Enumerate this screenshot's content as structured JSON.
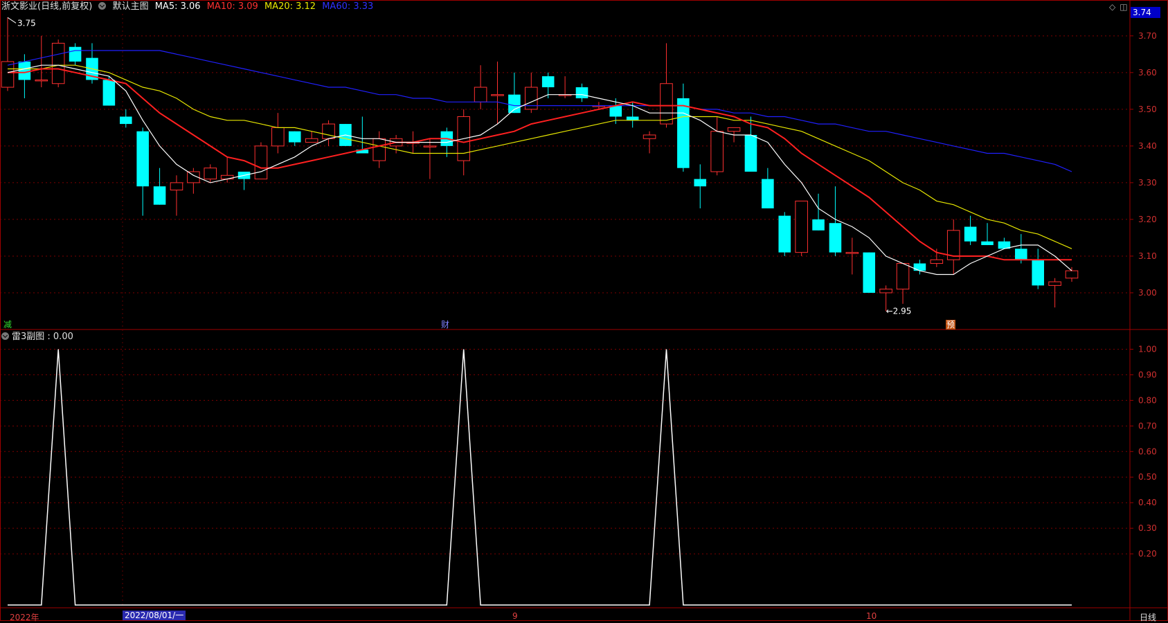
{
  "header": {
    "stock": "浙文影业(日线,前复权)",
    "template": "默认主图",
    "ma5": "MA5: 3.06",
    "ma10": "MA10: 3.09",
    "ma20": "MA20: 3.12",
    "ma60": "MA60: 3.33"
  },
  "indicator_header": "雷3副图 : 0.00",
  "current_price": "3.74",
  "high_label": "3.75",
  "low_label": "2.95",
  "event_markers": [
    "减",
    "财",
    "预"
  ],
  "bottom_labels": {
    "year": "2022年",
    "selected_date": "2022/08/01/一",
    "sep": "9",
    "oct": "10",
    "period": "日线"
  },
  "colors": {
    "up": "#ff3030",
    "down": "#00ffff",
    "ma5": "#ffffff",
    "ma10": "#ff2020",
    "ma20": "#e8e800",
    "ma60": "#2020ff",
    "axis": "#a00000"
  },
  "icons": [
    "diamond-icon",
    "window-icon",
    "collapse-icon"
  ],
  "chart_data": [
    {
      "type": "candlestick",
      "ylim": [
        2.9,
        3.76
      ],
      "yticks": [
        3.0,
        3.1,
        3.2,
        3.3,
        3.4,
        3.5,
        3.6,
        3.7
      ],
      "ohlc": [
        [
          3.56,
          3.75,
          3.55,
          3.63
        ],
        [
          3.63,
          3.65,
          3.53,
          3.58
        ],
        [
          3.58,
          3.7,
          3.56,
          3.58
        ],
        [
          3.57,
          3.69,
          3.56,
          3.68
        ],
        [
          3.67,
          3.68,
          3.62,
          3.63
        ],
        [
          3.64,
          3.68,
          3.57,
          3.58
        ],
        [
          3.58,
          3.59,
          3.51,
          3.51
        ],
        [
          3.48,
          3.5,
          3.45,
          3.46
        ],
        [
          3.44,
          3.45,
          3.21,
          3.29
        ],
        [
          3.29,
          3.34,
          3.24,
          3.24
        ],
        [
          3.28,
          3.32,
          3.21,
          3.3
        ],
        [
          3.3,
          3.34,
          3.27,
          3.33
        ],
        [
          3.31,
          3.35,
          3.3,
          3.34
        ],
        [
          3.31,
          3.37,
          3.3,
          3.32
        ],
        [
          3.33,
          3.33,
          3.28,
          3.31
        ],
        [
          3.31,
          3.41,
          3.31,
          3.4
        ],
        [
          3.4,
          3.49,
          3.38,
          3.45
        ],
        [
          3.44,
          3.44,
          3.4,
          3.41
        ],
        [
          3.41,
          3.44,
          3.41,
          3.42
        ],
        [
          3.42,
          3.47,
          3.4,
          3.46
        ],
        [
          3.46,
          3.46,
          3.4,
          3.4
        ],
        [
          3.39,
          3.48,
          3.38,
          3.38
        ],
        [
          3.36,
          3.44,
          3.34,
          3.42
        ],
        [
          3.4,
          3.43,
          3.38,
          3.42
        ],
        [
          3.41,
          3.44,
          3.38,
          3.41
        ],
        [
          3.4,
          3.42,
          3.31,
          3.4
        ],
        [
          3.44,
          3.45,
          3.37,
          3.4
        ],
        [
          3.36,
          3.5,
          3.32,
          3.48
        ],
        [
          3.52,
          3.62,
          3.5,
          3.56
        ],
        [
          3.54,
          3.63,
          3.46,
          3.54
        ],
        [
          3.54,
          3.6,
          3.49,
          3.49
        ],
        [
          3.5,
          3.6,
          3.49,
          3.56
        ],
        [
          3.59,
          3.6,
          3.53,
          3.56
        ],
        [
          3.54,
          3.59,
          3.53,
          3.54
        ],
        [
          3.56,
          3.57,
          3.52,
          3.53
        ],
        [
          3.51,
          3.52,
          3.5,
          3.51
        ],
        [
          3.51,
          3.53,
          3.46,
          3.48
        ],
        [
          3.48,
          3.52,
          3.45,
          3.47
        ],
        [
          3.42,
          3.44,
          3.38,
          3.43
        ],
        [
          3.46,
          3.68,
          3.45,
          3.57
        ],
        [
          3.53,
          3.57,
          3.33,
          3.34
        ],
        [
          3.31,
          3.35,
          3.23,
          3.29
        ],
        [
          3.33,
          3.48,
          3.32,
          3.44
        ],
        [
          3.44,
          3.45,
          3.41,
          3.45
        ],
        [
          3.43,
          3.48,
          3.33,
          3.33
        ],
        [
          3.31,
          3.34,
          3.23,
          3.23
        ],
        [
          3.21,
          3.22,
          3.1,
          3.11
        ],
        [
          3.11,
          3.25,
          3.1,
          3.25
        ],
        [
          3.2,
          3.27,
          3.17,
          3.17
        ],
        [
          3.19,
          3.29,
          3.1,
          3.11
        ],
        [
          3.11,
          3.15,
          3.05,
          3.11
        ],
        [
          3.11,
          3.11,
          3.0,
          3.0
        ],
        [
          3.0,
          3.02,
          2.95,
          3.01
        ],
        [
          3.01,
          3.08,
          2.97,
          3.08
        ],
        [
          3.08,
          3.09,
          3.05,
          3.06
        ],
        [
          3.08,
          3.12,
          3.07,
          3.09
        ],
        [
          3.09,
          3.2,
          3.05,
          3.17
        ],
        [
          3.18,
          3.21,
          3.13,
          3.14
        ],
        [
          3.14,
          3.19,
          3.13,
          3.13
        ],
        [
          3.14,
          3.15,
          3.12,
          3.12
        ],
        [
          3.12,
          3.16,
          3.08,
          3.09
        ],
        [
          3.09,
          3.12,
          3.01,
          3.02
        ],
        [
          3.02,
          3.04,
          2.96,
          3.03
        ],
        [
          3.04,
          3.07,
          3.03,
          3.06
        ]
      ],
      "ma5": [
        3.6,
        3.61,
        3.62,
        3.62,
        3.61,
        3.6,
        3.59,
        3.55,
        3.47,
        3.4,
        3.35,
        3.32,
        3.3,
        3.31,
        3.32,
        3.33,
        3.35,
        3.37,
        3.4,
        3.42,
        3.43,
        3.42,
        3.42,
        3.41,
        3.41,
        3.41,
        3.41,
        3.42,
        3.43,
        3.46,
        3.5,
        3.52,
        3.54,
        3.54,
        3.54,
        3.53,
        3.52,
        3.51,
        3.49,
        3.49,
        3.49,
        3.47,
        3.44,
        3.43,
        3.43,
        3.41,
        3.35,
        3.3,
        3.23,
        3.2,
        3.18,
        3.15,
        3.1,
        3.08,
        3.06,
        3.05,
        3.05,
        3.08,
        3.1,
        3.12,
        3.13,
        3.13,
        3.1,
        3.06
      ],
      "ma10": [
        3.6,
        3.6,
        3.61,
        3.61,
        3.6,
        3.59,
        3.58,
        3.57,
        3.53,
        3.49,
        3.46,
        3.43,
        3.4,
        3.37,
        3.36,
        3.34,
        3.34,
        3.35,
        3.36,
        3.37,
        3.38,
        3.39,
        3.4,
        3.41,
        3.41,
        3.42,
        3.42,
        3.41,
        3.42,
        3.43,
        3.44,
        3.46,
        3.47,
        3.48,
        3.49,
        3.5,
        3.51,
        3.52,
        3.51,
        3.51,
        3.51,
        3.5,
        3.49,
        3.48,
        3.46,
        3.45,
        3.42,
        3.38,
        3.35,
        3.32,
        3.29,
        3.26,
        3.22,
        3.18,
        3.14,
        3.11,
        3.1,
        3.1,
        3.1,
        3.09,
        3.09,
        3.09,
        3.09,
        3.09
      ],
      "ma20": [
        3.61,
        3.61,
        3.61,
        3.62,
        3.62,
        3.61,
        3.6,
        3.58,
        3.56,
        3.55,
        3.53,
        3.5,
        3.48,
        3.47,
        3.47,
        3.46,
        3.45,
        3.45,
        3.44,
        3.43,
        3.42,
        3.41,
        3.4,
        3.39,
        3.38,
        3.38,
        3.38,
        3.38,
        3.39,
        3.4,
        3.41,
        3.42,
        3.43,
        3.44,
        3.45,
        3.46,
        3.47,
        3.47,
        3.47,
        3.47,
        3.48,
        3.48,
        3.48,
        3.47,
        3.47,
        3.46,
        3.45,
        3.44,
        3.42,
        3.4,
        3.38,
        3.36,
        3.33,
        3.3,
        3.28,
        3.25,
        3.24,
        3.22,
        3.2,
        3.19,
        3.17,
        3.16,
        3.14,
        3.12
      ],
      "ma60": [
        3.62,
        3.63,
        3.64,
        3.65,
        3.66,
        3.66,
        3.66,
        3.66,
        3.66,
        3.66,
        3.65,
        3.64,
        3.63,
        3.62,
        3.61,
        3.6,
        3.59,
        3.58,
        3.57,
        3.56,
        3.56,
        3.55,
        3.54,
        3.54,
        3.53,
        3.53,
        3.52,
        3.52,
        3.52,
        3.52,
        3.51,
        3.51,
        3.51,
        3.51,
        3.51,
        3.51,
        3.51,
        3.51,
        3.51,
        3.51,
        3.51,
        3.5,
        3.5,
        3.49,
        3.49,
        3.48,
        3.48,
        3.47,
        3.46,
        3.46,
        3.45,
        3.44,
        3.44,
        3.43,
        3.42,
        3.41,
        3.4,
        3.39,
        3.38,
        3.38,
        3.37,
        3.36,
        3.35,
        3.33
      ]
    },
    {
      "type": "line",
      "name": "雷3副图",
      "ylim": [
        0.0,
        1.05
      ],
      "yticks": [
        0.2,
        0.3,
        0.4,
        0.5,
        0.6,
        0.7,
        0.8,
        0.9,
        1.0
      ],
      "values": [
        0,
        0,
        0,
        1,
        0,
        0,
        0,
        0,
        0,
        0,
        0,
        0,
        0,
        0,
        0,
        0,
        0,
        0,
        0,
        0,
        0,
        0,
        0,
        0,
        0,
        0,
        0,
        1,
        0,
        0,
        0,
        0,
        0,
        0,
        0,
        0,
        0,
        0,
        0,
        1,
        0,
        0,
        0,
        0,
        0,
        0,
        0,
        0,
        0,
        0,
        0,
        0,
        0,
        0,
        0,
        0,
        0,
        0,
        0,
        0,
        0,
        0,
        0,
        0
      ]
    }
  ]
}
